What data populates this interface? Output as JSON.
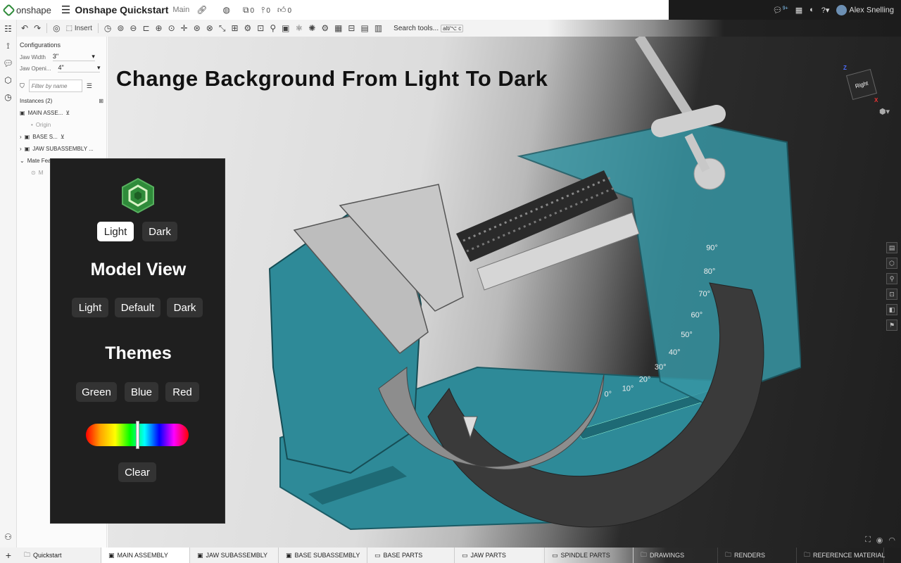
{
  "app": {
    "name": "onshape",
    "doc_title": "Onshape Quickstart",
    "branch": "Main",
    "copies_count": "0",
    "versions_count": "0",
    "likes_count": "0"
  },
  "user": {
    "name": "Alex Snelling",
    "notification_count": "9+"
  },
  "toolbar": {
    "insert_label": "Insert",
    "search_label": "Search tools...",
    "search_shortcut": "alt/⌥ c"
  },
  "panel": {
    "configurations_label": "Configurations",
    "config_rows": [
      {
        "label": "Jaw Width",
        "value": "3\""
      },
      {
        "label": "Jaw Openi...",
        "value": "4\""
      }
    ],
    "filter_placeholder": "Filter by name",
    "instances_label": "Instances (2)",
    "tree": [
      {
        "label": "MAIN ASSE..."
      },
      {
        "label": "Origin"
      },
      {
        "label": "BASE S..."
      },
      {
        "label": "JAW SUBASSEMBLY ..."
      },
      {
        "label": "Mate Fea"
      },
      {
        "label": "M"
      }
    ]
  },
  "canvas": {
    "title": "Change Background From Light To Dark",
    "viewcube_face": "Right"
  },
  "overlay": {
    "bg_buttons": [
      {
        "label": "Light",
        "active": true
      },
      {
        "label": "Dark",
        "active": false
      }
    ],
    "model_view_heading": "Model View",
    "model_view_buttons": [
      "Light",
      "Default",
      "Dark"
    ],
    "themes_heading": "Themes",
    "theme_buttons": [
      "Green",
      "Blue",
      "Red"
    ],
    "hue_value": 0.5,
    "clear_label": "Clear"
  },
  "protractor_labels": [
    "0°",
    "10°",
    "20°",
    "30°",
    "40°",
    "50°",
    "60°",
    "70°",
    "80°",
    "90°"
  ],
  "tabs": [
    {
      "label": "Quickstart",
      "icon": "folder-icon"
    },
    {
      "label": "MAIN ASSEMBLY",
      "icon": "assembly-icon",
      "active": true
    },
    {
      "label": "JAW SUBASSEMBLY",
      "icon": "assembly-icon"
    },
    {
      "label": "BASE SUBASSEMBLY",
      "icon": "assembly-icon"
    },
    {
      "label": "BASE PARTS",
      "icon": "part-studio-icon"
    },
    {
      "label": "JAW PARTS",
      "icon": "part-studio-icon"
    },
    {
      "label": "SPINDLE PARTS",
      "icon": "part-studio-icon"
    },
    {
      "label": "DRAWINGS",
      "icon": "folder-icon"
    },
    {
      "label": "RENDERS",
      "icon": "folder-icon"
    },
    {
      "label": "REFERENCE MATERIAL",
      "icon": "folder-icon"
    }
  ],
  "colors": {
    "brand_green": "#2f8b3a",
    "part_teal": "#2e8a98",
    "overlay_bg": "#1f1f1f"
  }
}
